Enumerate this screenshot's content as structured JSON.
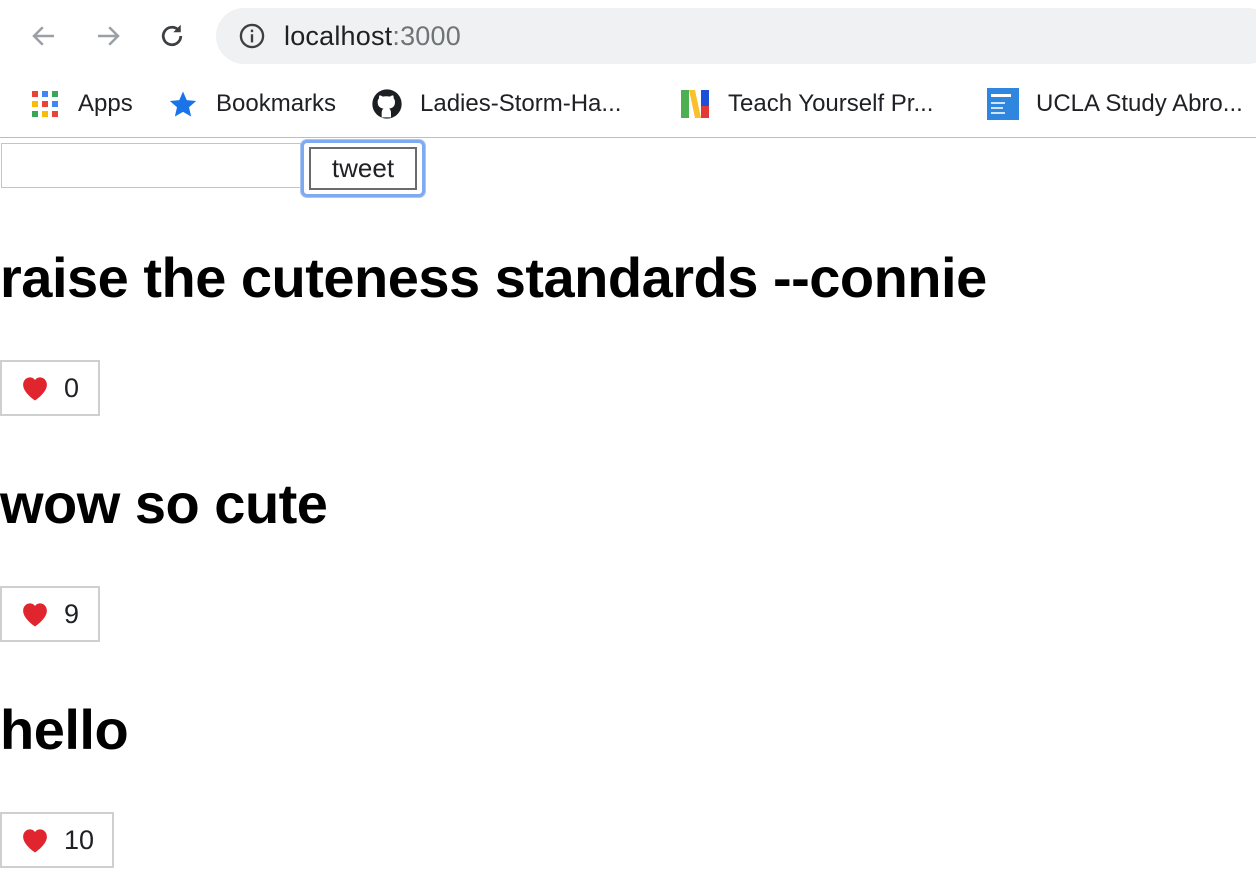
{
  "browser": {
    "url_host": "localhost",
    "url_port": ":3000",
    "bookmarks": [
      {
        "label": "Apps",
        "icon": "apps-grid-icon"
      },
      {
        "label": "Bookmarks",
        "icon": "star-icon"
      },
      {
        "label": "Ladies-Storm-Ha...",
        "icon": "github-icon"
      },
      {
        "label": "Teach Yourself Pr...",
        "icon": "n-logo-icon"
      },
      {
        "label": "UCLA Study Abro...",
        "icon": "ucla-icon"
      }
    ]
  },
  "composer": {
    "input_value": "",
    "button_label": "tweet"
  },
  "tweets": [
    {
      "text": "raise the cuteness standards --connie",
      "likes": "0"
    },
    {
      "text": "wow so cute",
      "likes": "9"
    },
    {
      "text": "hello",
      "likes": "10"
    }
  ],
  "colors": {
    "heart": "#e0252f",
    "focus_ring": "#7faaf0",
    "star": "#1a73e8"
  }
}
